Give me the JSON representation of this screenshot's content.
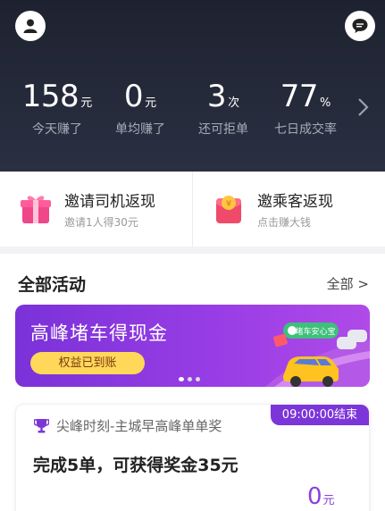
{
  "header": {
    "stats": [
      {
        "value": "158",
        "unit": "元",
        "label": "今天赚了"
      },
      {
        "value": "0",
        "unit": "元",
        "label": "单均赚了"
      },
      {
        "value": "3",
        "unit": "次",
        "label": "还可拒单"
      },
      {
        "value": "77",
        "unit": "%",
        "label": "七日成交率"
      }
    ]
  },
  "invites": [
    {
      "title": "邀请司机返现",
      "subtitle": "邀请1人得30元"
    },
    {
      "title": "邀乘客返现",
      "subtitle": "点击赚大钱"
    }
  ],
  "activities": {
    "title": "全部活动",
    "all_link": "全部 >",
    "banner": {
      "title": "高峰堵车得现金",
      "button": "权益已到账",
      "art_label": "堵车安心宝"
    },
    "card": {
      "badge": "09:00:00结束",
      "header": "尖峰时刻-主城早高峰单单奖",
      "body": "完成5单，可获得奖金35元",
      "amount": "0",
      "amount_unit": "元"
    }
  },
  "colors": {
    "header_bg": "#1e2230",
    "accent_purple": "#7b35d9",
    "banner_button": "#ffd85a"
  }
}
